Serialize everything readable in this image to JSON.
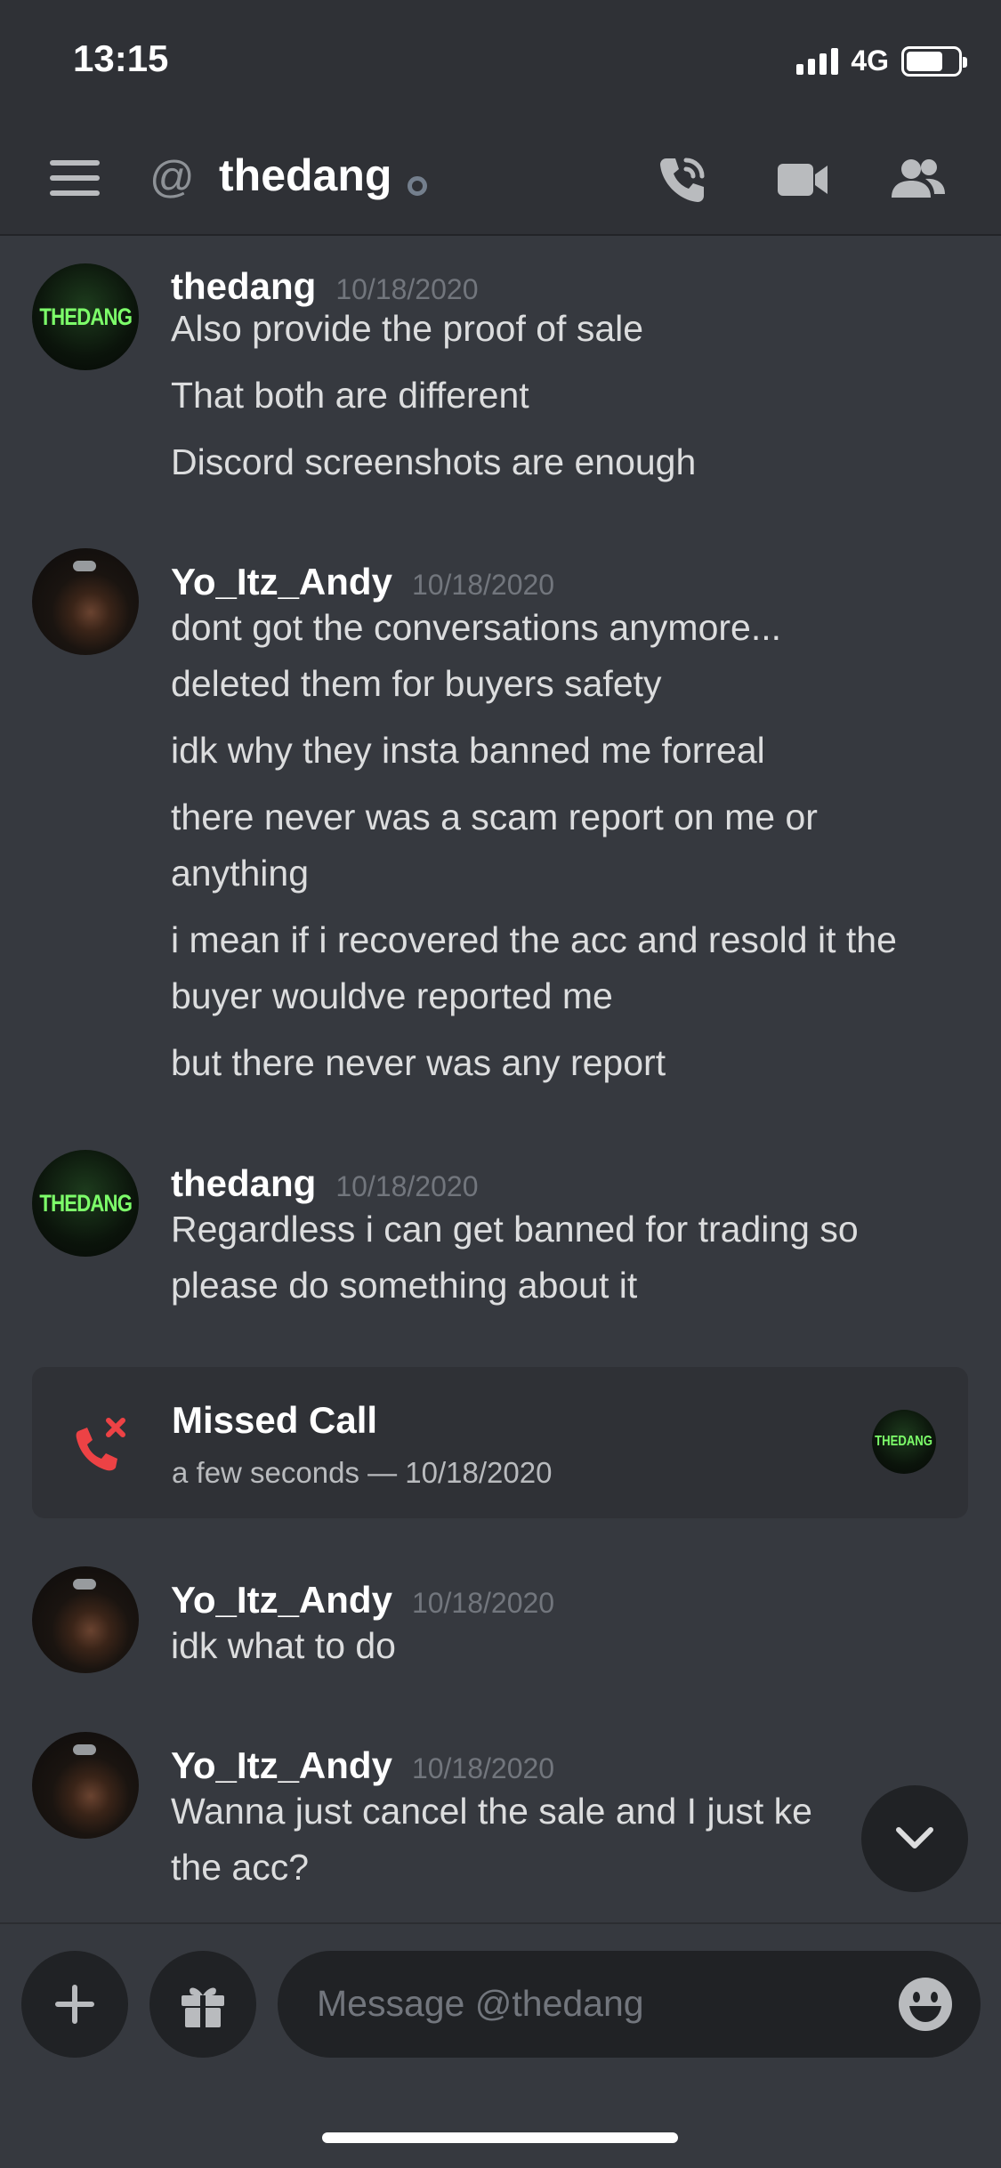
{
  "status_bar": {
    "time": "13:15",
    "network": "4G"
  },
  "header": {
    "at_symbol": "@",
    "channel_name": "thedang"
  },
  "messages": [
    {
      "author": "thedang",
      "timestamp": "10/18/2020",
      "avatar_text": "THEDANG",
      "lines": [
        "Also provide the proof of sale",
        "That both are different",
        "Discord screenshots are enough"
      ]
    },
    {
      "author": "Yo_Itz_Andy",
      "timestamp": "10/18/2020",
      "lines": [
        "dont got the conversations anymore...",
        "deleted them for buyers safety",
        "idk why they insta banned me forreal",
        "there never was a scam report on me or",
        "anything",
        "i mean if i recovered the acc and resold it the",
        "buyer wouldve reported me",
        "but there never was any report"
      ]
    },
    {
      "author": "thedang",
      "timestamp": "10/18/2020",
      "avatar_text": "THEDANG",
      "lines": [
        "Regardless i can get banned for trading so",
        "please do something about it"
      ]
    },
    {
      "author": "Yo_Itz_Andy",
      "timestamp": "10/18/2020",
      "lines": [
        "idk what to do"
      ]
    },
    {
      "author": "Yo_Itz_Andy",
      "timestamp": "10/18/2020",
      "lines": [
        "Wanna just cancel the sale and I just ke",
        "the acc?"
      ]
    }
  ],
  "missed_call": {
    "title": "Missed Call",
    "subtitle": "a few seconds — 10/18/2020",
    "avatar_text": "THEDANG"
  },
  "composer": {
    "placeholder": "Message @thedang"
  },
  "colors": {
    "background": "#36393f",
    "header": "#2f3136",
    "missed_call_red": "#ed4245",
    "thedang_logo_green": "#7dff6a"
  },
  "icons": [
    "hamburger-icon",
    "at-icon",
    "phone-call-icon",
    "video-camera-icon",
    "members-icon",
    "missed-call-icon",
    "chevron-down-icon",
    "plus-icon",
    "gift-icon",
    "emoji-icon"
  ]
}
